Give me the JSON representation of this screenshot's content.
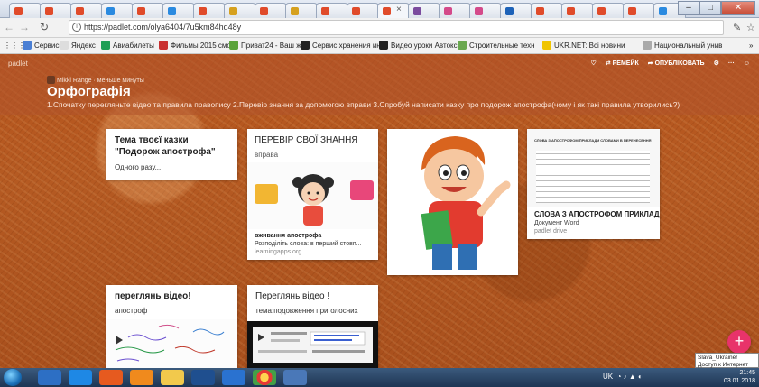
{
  "browser": {
    "url": "https://padlet.com/olya6404/7u5km84hd48y",
    "tab_close_glyph": "×",
    "bookmarks": [
      {
        "label": "Сервисы",
        "color": "#4a7fd4"
      },
      {
        "label": "Яндекс",
        "color": "#dddddd"
      },
      {
        "label": "Авиабилеты",
        "color": "#1f9e55"
      },
      {
        "label": "Фильмы 2015 смотр",
        "color": "#c93030"
      },
      {
        "label": "Приват24 - Ваш жит",
        "color": "#5aa33a"
      },
      {
        "label": "Сервис хранения ин",
        "color": "#222222"
      },
      {
        "label": "Видео уроки Автокс",
        "color": "#222222"
      },
      {
        "label": "Строительные техн",
        "color": "#6aa84f"
      },
      {
        "label": "UKR.NET: Всі новини",
        "color": "#f0c400"
      },
      {
        "label": "Национальный унив",
        "color": "#aaaaaa"
      }
    ]
  },
  "padlet": {
    "brand": "padlet",
    "toolbar": {
      "remake": "РЕМЕЙК",
      "publish": "ОПУБЛІКОВАТЬ"
    },
    "author": "Mikki Range",
    "time": "меньше минуты",
    "title": "Орфографія",
    "description": "1.Спочатку перегляньте відео та правила правопису 2.Перевір знання за допомогою вправи 3.Спробуй написати казку про подорож апострофа(чому і як такі правила утворились?)",
    "cards": {
      "tale": {
        "title": "Тема твоєї  казки \"Подорож апострофа\"",
        "body": "Одного разу..."
      },
      "check": {
        "title": "ПЕРЕВІР СВОЇ ЗНАННЯ",
        "subtitle": "вправа",
        "link_title": "вживання апострофа",
        "link_desc": "Розподіліть слова: в перший стовп...",
        "link_domain": "learningapps.org"
      },
      "word": {
        "title": "СЛОВА З АПОСТРОФОМ ПРИКЛАД...",
        "type": "Документ Word",
        "source": "padlet drive",
        "doc_heading": "СЛОВА З АПОСТРОФОМ ПРИКЛАДИ СЛОВАМИ В ПЕРЕНЕСЕННЯ"
      },
      "video1": {
        "title": "переглянь відео!",
        "body": "апостроф"
      },
      "video2": {
        "title": "Переглянь відео !",
        "body": "тема:подовження приголосних"
      }
    },
    "fab": "+",
    "tooltip": [
      "Slava_Ukraine!",
      "Доступ к Интернет"
    ]
  },
  "taskbar": {
    "lang": "UK",
    "time": "21:45",
    "date": "03.01.2018"
  },
  "colors": {
    "accent": "#e8336a",
    "header": "#b0542c",
    "background": "#b8561e"
  }
}
